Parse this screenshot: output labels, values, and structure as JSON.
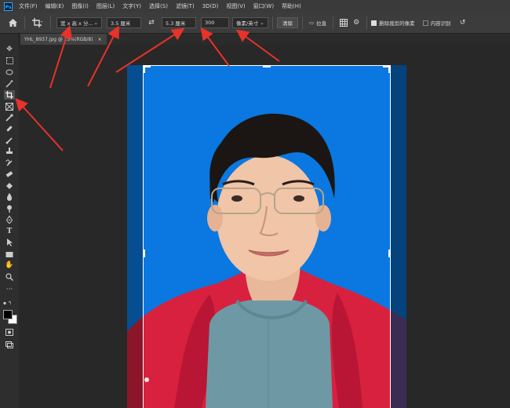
{
  "app": {
    "logo": "Ps"
  },
  "menu": [
    "文件(F)",
    "编辑(E)",
    "图像(I)",
    "图层(L)",
    "文字(Y)",
    "选择(S)",
    "滤镜(T)",
    "3D(D)",
    "视图(V)",
    "窗口(W)",
    "帮助(H)"
  ],
  "options": {
    "ratio_select": "宽 x 高 x 分...",
    "width": "3.5 厘米",
    "swap_icon": "⇄",
    "height": "5.3 厘米",
    "resolution": "300",
    "unit_select": "像素/英寸",
    "clear_button": "清除",
    "straighten": "拉直",
    "delete_cropped": "删除裁剪的像素",
    "content_aware": "内容识别"
  },
  "document": {
    "tab_title": "YHL_8937.jpg @ 25%(RGB/8)",
    "close": "×"
  },
  "tools": [
    "move-icon",
    "marquee-icon",
    "lasso-icon",
    "magic-wand-icon",
    "crop-icon",
    "frame-icon",
    "eyedropper-icon",
    "healing-icon",
    "brush-icon",
    "stamp-icon",
    "history-brush-icon",
    "eraser-icon",
    "paint-bucket-icon",
    "blur-icon",
    "dodge-icon",
    "pen-icon",
    "type-icon",
    "path-select-icon",
    "rectangle-icon",
    "hand-icon",
    "zoom-icon",
    "more-icon"
  ],
  "colors": {
    "photo_bg": "#0a78e0",
    "jacket": "#e0264a",
    "sweater": "#6e99a4",
    "arrow": "#e8322a"
  }
}
